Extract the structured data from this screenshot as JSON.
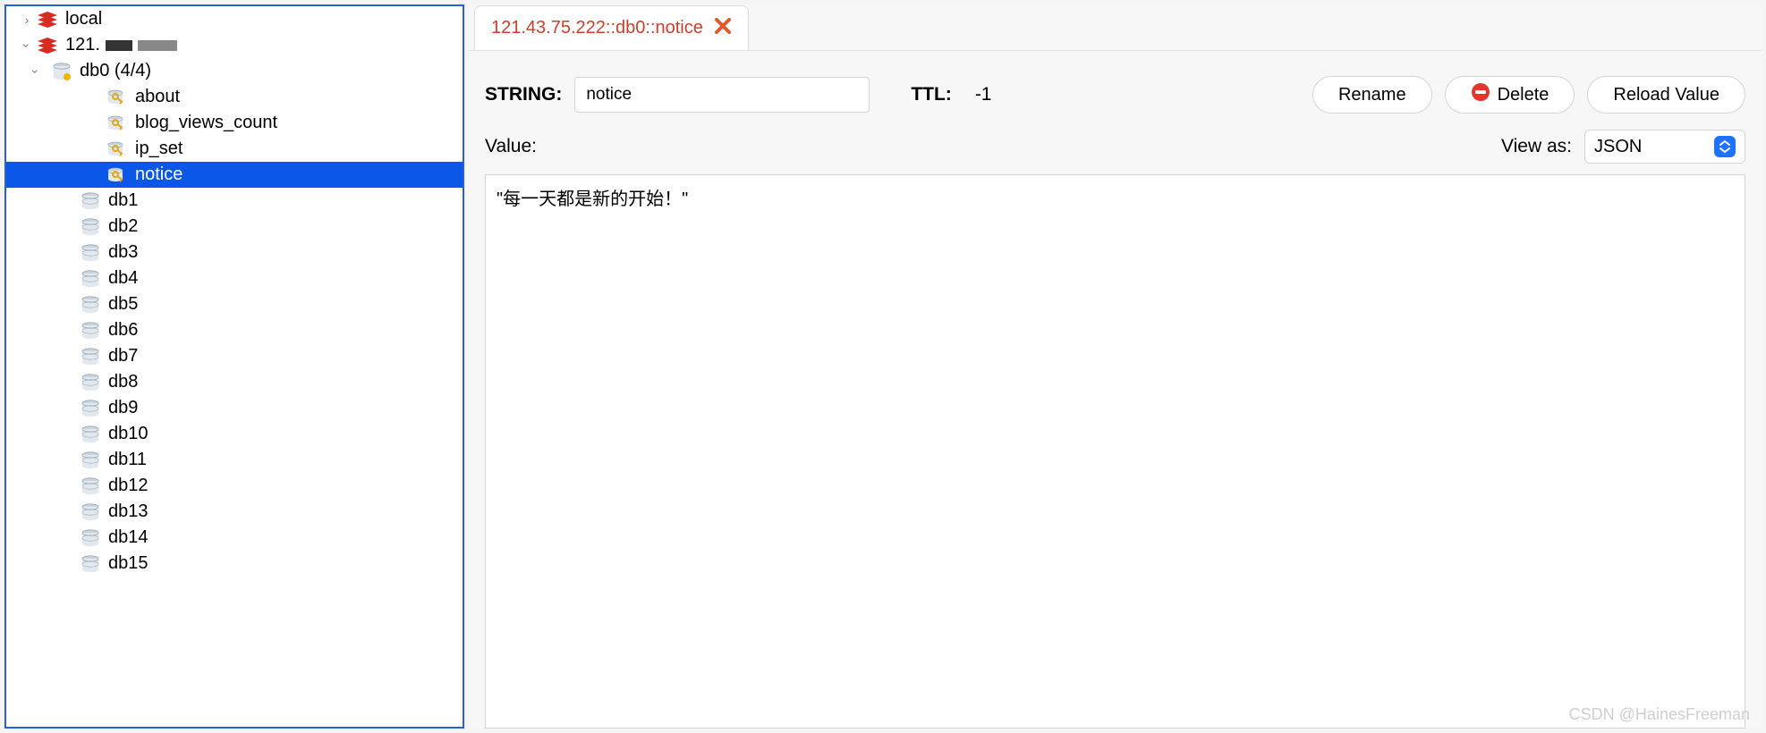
{
  "sidebar": {
    "connections": [
      {
        "name": "local",
        "expanded": false
      },
      {
        "name": "121.",
        "redacted": true,
        "expanded": true
      }
    ],
    "expanded_db": {
      "label": "db0 (4/4)"
    },
    "keys": [
      {
        "name": "about",
        "selected": false
      },
      {
        "name": "blog_views_count",
        "selected": false
      },
      {
        "name": "ip_set",
        "selected": false
      },
      {
        "name": "notice",
        "selected": true
      }
    ],
    "dbs": [
      "db1",
      "db2",
      "db3",
      "db4",
      "db5",
      "db6",
      "db7",
      "db8",
      "db9",
      "db10",
      "db11",
      "db12",
      "db13",
      "db14",
      "db15"
    ]
  },
  "tab": {
    "label": "121.43.75.222::db0::notice"
  },
  "form": {
    "type_label": "STRING:",
    "key_value": "notice",
    "ttl_label": "TTL:",
    "ttl_value": "-1",
    "rename_label": "Rename",
    "delete_label": "Delete",
    "reload_label": "Reload Value"
  },
  "value": {
    "label": "Value:",
    "view_as_label": "View as:",
    "view_as_value": "JSON",
    "content": "\"每一天都是新的开始！\""
  },
  "watermark": "CSDN @HainesFreeman"
}
